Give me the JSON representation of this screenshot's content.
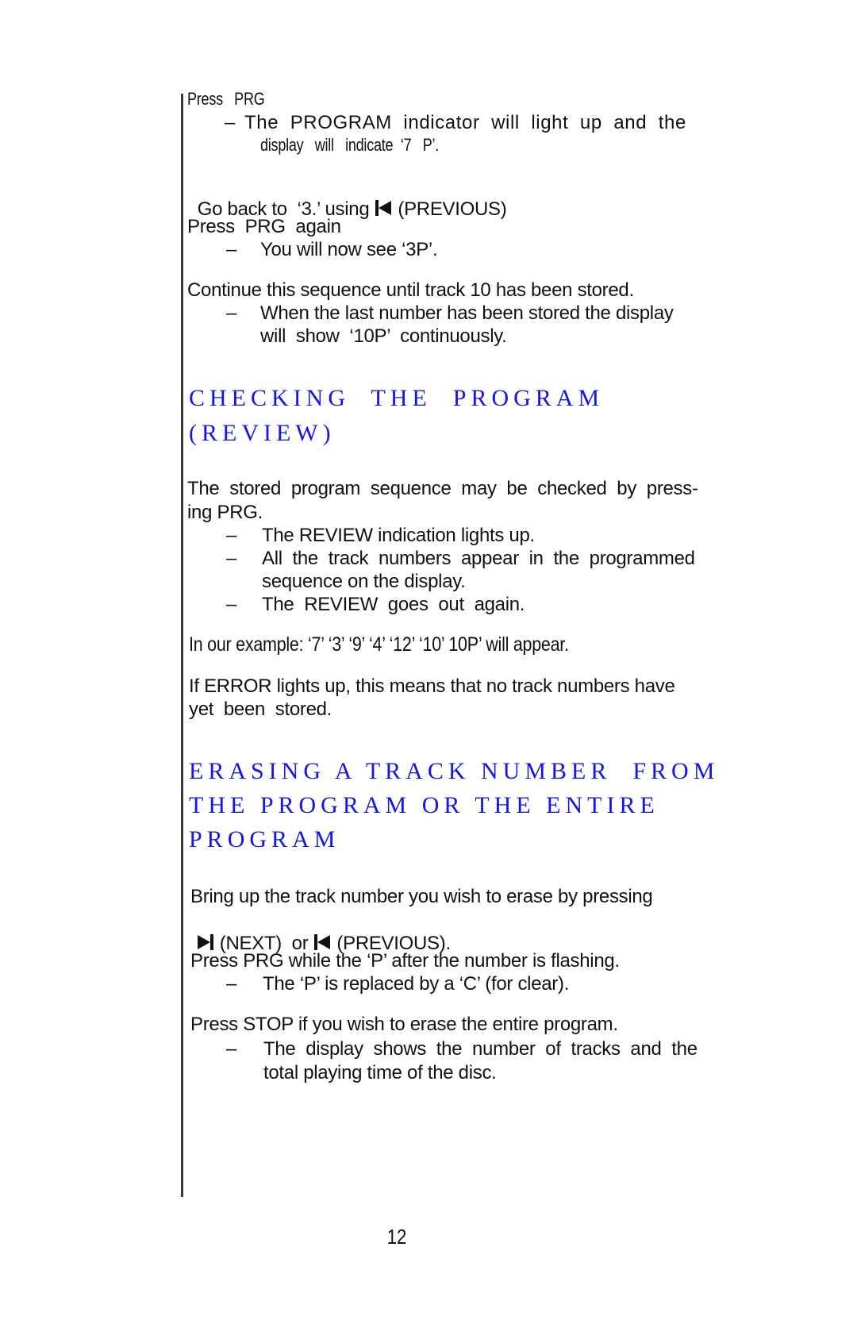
{
  "page": {
    "number": "12",
    "accent_color": "#1414ee"
  },
  "intro": {
    "press_prg": "Press   PRG",
    "program_indicator_line1": "The  PROGRAM  indicator  will  light  up  and  the",
    "program_indicator_line2": "display   will   indicate  ‘7   P’.",
    "go_back_prefix": "Go back to  ‘3.’ using",
    "go_back_suffix": "(PREVIOUS)",
    "press_prg_again": "Press  PRG  again",
    "see_3p": "You will now see ‘3P’.",
    "continue_sequence": "Continue this sequence until track 10 has been stored.",
    "last_stored_line1": "When the last number has been stored the display",
    "last_stored_line2": "will  show  ‘10P’  continuously."
  },
  "review_section": {
    "heading_line1": "CHECKING  THE  PROGRAM",
    "heading_line2": "(REVIEW)",
    "body_line1": "The  stored  program  sequence  may  be  checked  by  press-",
    "body_line2": "ing PRG.",
    "bullets": [
      "The REVIEW indication lights up.",
      "All  the  track  numbers  appear  in  the  programmed",
      "sequence on the display.",
      "The  REVIEW  goes  out  again."
    ],
    "example": "In our example: ‘7’ ‘3’ ‘9’ ‘4’ ‘12’ ‘10’ 10P’ will appear.",
    "error_line1": "If ERROR lights up, this means that no track numbers have",
    "error_line2": "yet  been  stored."
  },
  "erase_section": {
    "heading_line1": "ERASING A TRACK NUMBER  FROM",
    "heading_line2": "THE PROGRAM OR THE ENTIRE",
    "heading_line3": "PROGRAM",
    "bring_up_line1": "Bring up the track number you wish to erase by pressing",
    "next_label": "(NEXT)  or",
    "previous_label": "(PREVIOUS).",
    "press_prg_flashing": "Press PRG while the ‘P’ after the number is flashing.",
    "replaced_by_c": "The ‘P’ is replaced by a ‘C’ (for clear).",
    "press_stop": "Press STOP if you wish to erase the entire program.",
    "display_shows_line1": "The  display  shows  the  number  of  tracks  and  the",
    "display_shows_line2": "total playing time of the disc."
  },
  "icons": {
    "dash": "–"
  }
}
